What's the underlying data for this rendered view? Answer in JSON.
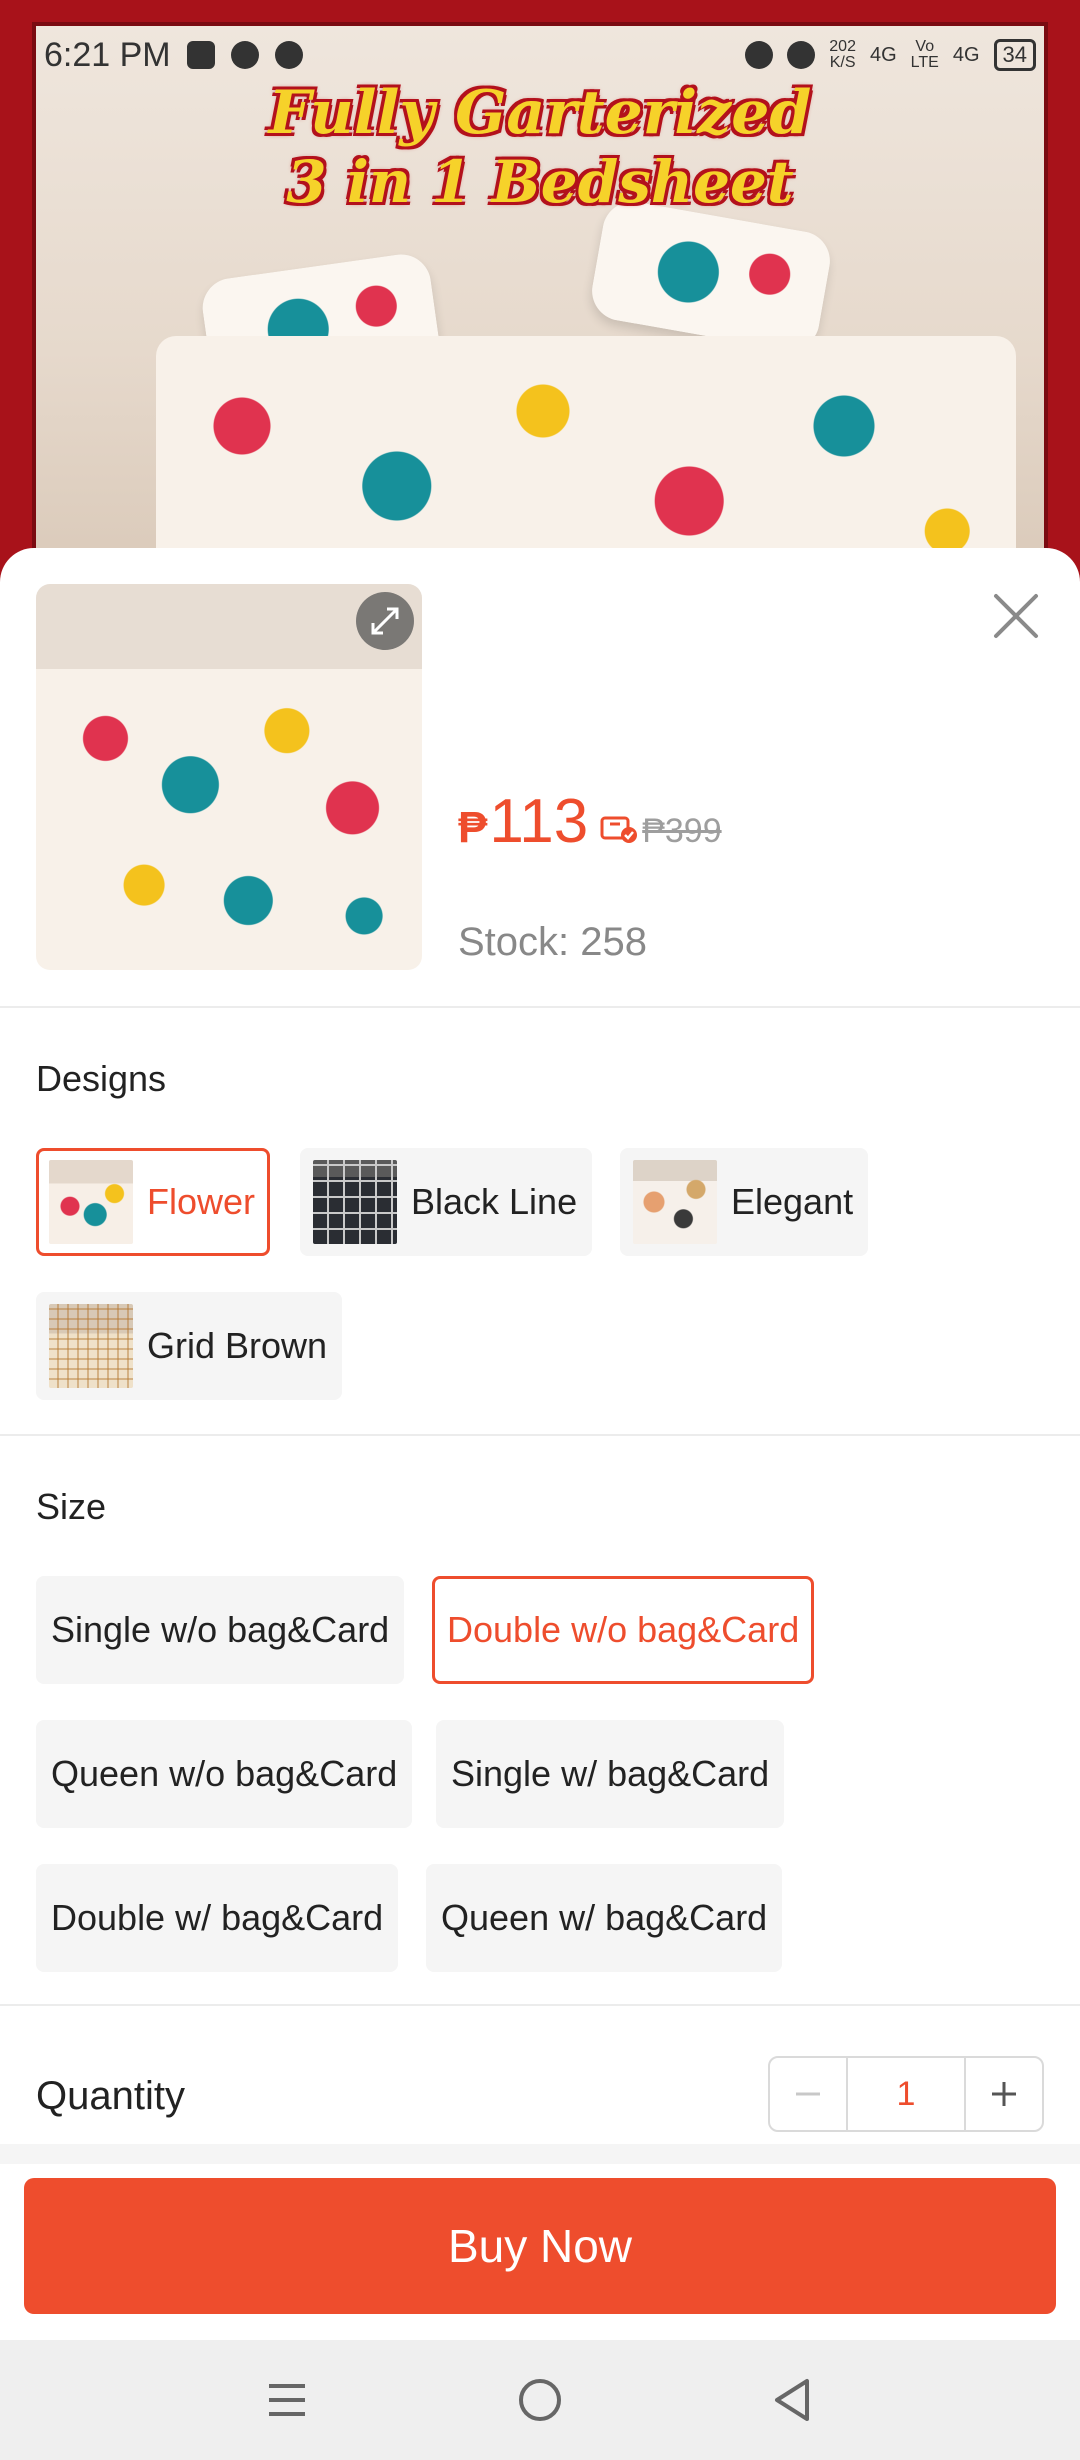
{
  "status_bar": {
    "time": "6:21 PM",
    "net_speed_value": "202",
    "net_speed_unit": "K/S",
    "network_1": "4G",
    "network_2_top": "Vo",
    "network_2_bottom": "LTE",
    "network_3": "4G",
    "battery": "34"
  },
  "banner": {
    "title_line1": "Fully Garterized",
    "title_line2": "3 in 1 Bedsheet"
  },
  "sheet": {
    "price_currency": "₱",
    "price": "113",
    "original_price": "₱399",
    "stock": "Stock: 258",
    "designs": {
      "title": "Designs",
      "options": [
        "Flower",
        "Black Line",
        "Elegant",
        "Grid Brown"
      ],
      "selected": "Flower"
    },
    "size": {
      "title": "Size",
      "options": [
        "Single w/o bag&Card",
        "Double w/o bag&Card",
        "Queen w/o bag&Card",
        "Single w/ bag&Card",
        "Double w/ bag&Card",
        "Queen w/ bag&Card"
      ],
      "selected": "Double w/o bag&Card"
    },
    "quantity": {
      "label": "Quantity",
      "value": "1"
    },
    "buy_button": "Buy Now"
  },
  "colors": {
    "accent": "#ee4d2d",
    "chip_bg": "#f5f5f5",
    "muted_text": "#888888"
  },
  "icons": {
    "close": "close-icon",
    "expand": "expand-icon",
    "voucher": "voucher-icon",
    "minus": "minus-icon",
    "plus": "plus-icon",
    "nav_menu": "menu-icon",
    "nav_home": "home-icon",
    "nav_back": "back-icon"
  }
}
